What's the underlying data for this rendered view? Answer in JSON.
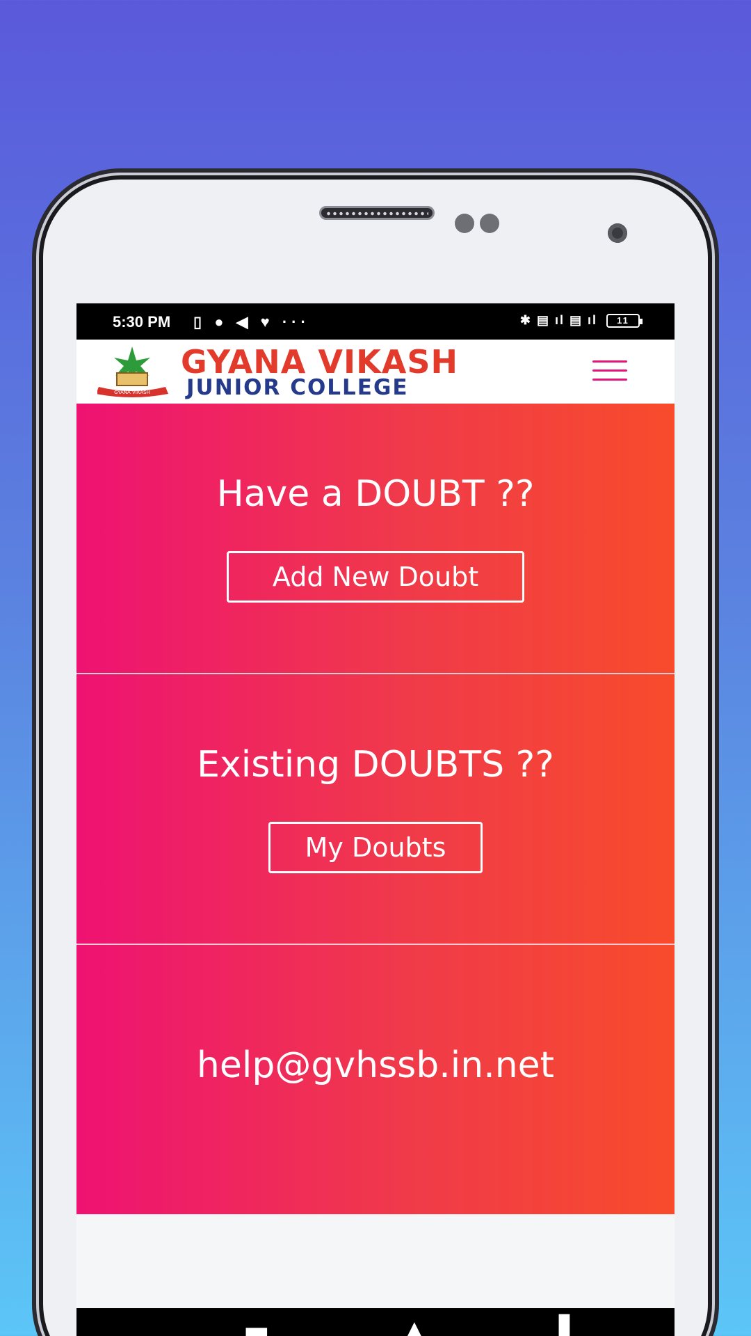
{
  "status_bar": {
    "time": "5:30 PM",
    "left_icons": "▯ ● ◀ ♥ ···",
    "right_icons": "✱ ▤ ıl ▤ ıl",
    "battery": "11"
  },
  "header": {
    "logo_title": "GYANA VIKASH",
    "logo_subtitle": "JUNIOR COLLEGE",
    "logo_emblem_text": "GYANA VIKASH"
  },
  "sections": [
    {
      "heading": "Have a DOUBT ??",
      "button": "Add New Doubt"
    },
    {
      "heading": "Existing DOUBTS ??",
      "button": "My Doubts"
    },
    {
      "heading": "help@gvhssb.in.net"
    }
  ],
  "colors": {
    "gradient_start": "#ee1272",
    "gradient_end": "#f84b2b",
    "menu_accent": "#e3177a",
    "logo_red": "#e23b2b",
    "logo_blue": "#263a8c"
  },
  "icons": [
    "menu-icon",
    "college-emblem-icon",
    "battery-icon",
    "wifi-signal-icon"
  ]
}
